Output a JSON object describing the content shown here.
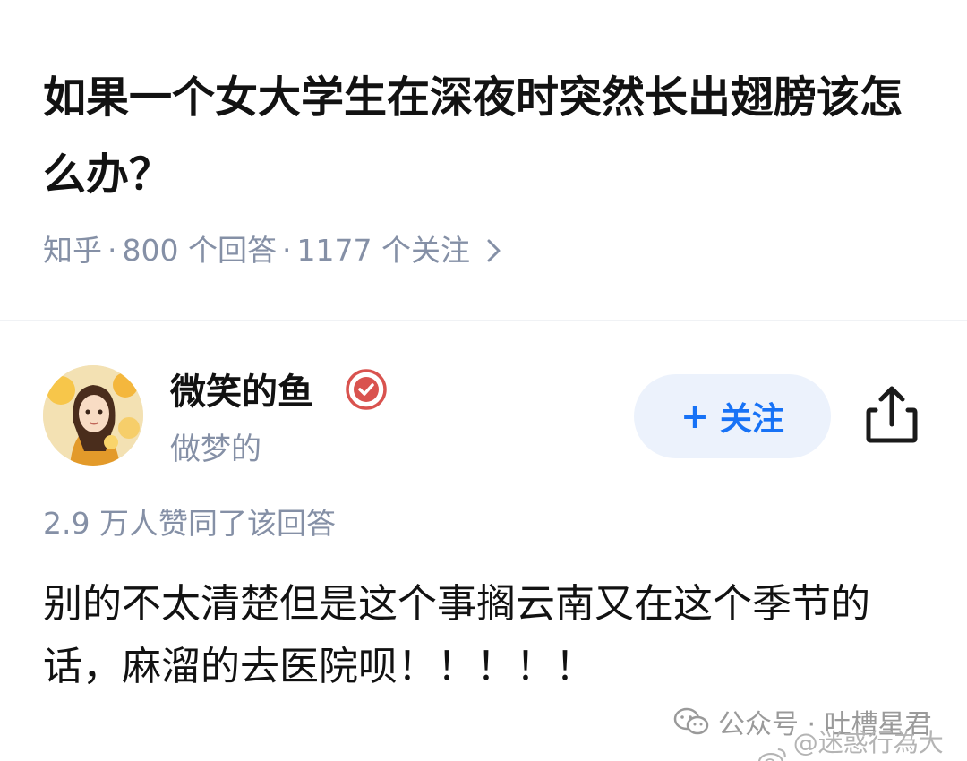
{
  "question": {
    "title": "如果一个女大学生在深夜时突然长出翅膀该怎么办？",
    "source": "知乎",
    "answers": "800 个回答",
    "follows": "1177 个关注",
    "separator": "·"
  },
  "author": {
    "name": "微笑的鱼",
    "subtitle": "做梦的",
    "follow_label": "关注",
    "follow_plus": "+"
  },
  "answer": {
    "upvotes": "2.9 万人赞同了该回答",
    "body": "别的不太清楚但是这个事搁云南又在这个季节的话，麻溜的去医院呗！！！！！"
  },
  "watermarks": {
    "wechat": "公众号 · 吐槽星君",
    "weibo": "@迷惑行為大賞"
  },
  "icons": {
    "verified": "verified-badge-icon",
    "share": "share-icon",
    "chevron": "chevron-right-icon",
    "wechat": "wechat-icon",
    "weibo": "weibo-icon"
  },
  "colors": {
    "accent": "#1772f6",
    "follow_bg": "#ecf2fc",
    "meta_gray": "#8590a6",
    "verified_red": "#d9534f"
  }
}
